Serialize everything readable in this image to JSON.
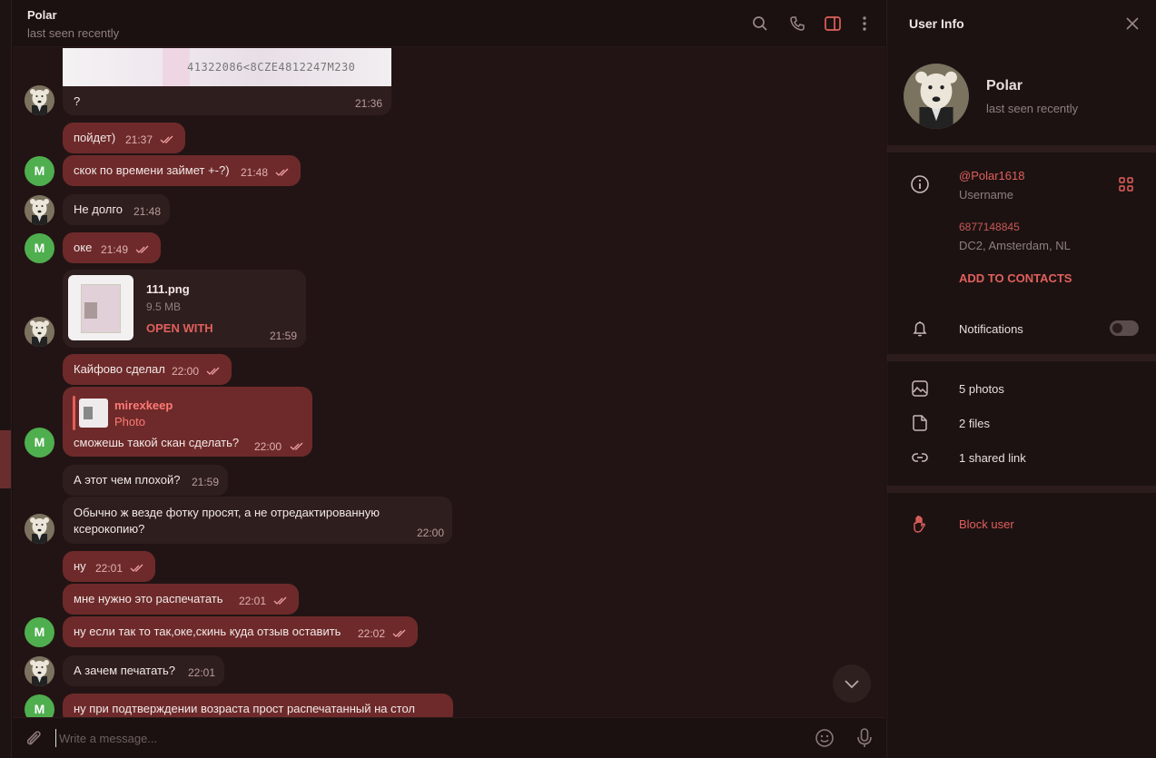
{
  "chat": {
    "title": "Polar",
    "status": "last seen recently",
    "composer_placeholder": "Write a message..."
  },
  "image_preview_text": "41322086<8CZE4812247M230",
  "messages": [
    {
      "dir": "in",
      "text": "?",
      "time": "21:36"
    },
    {
      "dir": "out",
      "text": "пойдет)",
      "time": "21:37"
    },
    {
      "dir": "out",
      "text": "скок по времени займет +-?)",
      "time": "21:48"
    },
    {
      "dir": "in",
      "text": "Не долго",
      "time": "21:48"
    },
    {
      "dir": "out",
      "text": "оке",
      "time": "21:49"
    },
    {
      "dir": "in",
      "file_name": "111.png",
      "file_size": "9.5 MB",
      "file_action": "OPEN WITH",
      "time": "21:59"
    },
    {
      "dir": "out",
      "text": "Кайфово сделал",
      "time": "22:00"
    },
    {
      "dir": "out",
      "reply_name": "mirexkeep",
      "reply_type": "Photo",
      "text": "сможешь такой скан сделать?",
      "time": "22:00"
    },
    {
      "dir": "in",
      "text": "А этот чем плохой?",
      "time": "21:59"
    },
    {
      "dir": "in",
      "text": "Обычно ж везде фотку просят, а не отредактированную",
      "text2": "ксерокопию?",
      "time": "22:00"
    },
    {
      "dir": "out",
      "text": "ну",
      "time": "22:01"
    },
    {
      "dir": "out",
      "text": "мне нужно это распечатать",
      "time": "22:01"
    },
    {
      "dir": "out",
      "text": "ну если так то так,оке,скинь куда отзыв оставить",
      "time": "22:02"
    },
    {
      "dir": "in",
      "text": "А зачем печатать?",
      "time": "22:01"
    },
    {
      "dir": "out",
      "text": "ну при подтверждении возраста прост распечатанный на стол"
    }
  ],
  "avatar_letter": "M",
  "panel": {
    "title": "User Info",
    "name": "Polar",
    "status": "last seen recently",
    "username": "@Polar1618",
    "username_label": "Username",
    "user_id": "6877148845",
    "dc": "DC2, Amsterdam, NL",
    "add_contacts": "ADD TO CONTACTS",
    "notifications": "Notifications",
    "notifications_on": false,
    "photos": "5 photos",
    "files": "2 files",
    "links": "1 shared link",
    "block": "Block user"
  },
  "colors": {
    "accent": "#e0605c",
    "outgoing": "#6e2a2a",
    "incoming": "#2f1e1e",
    "avatar_green": "#4fae4e"
  }
}
